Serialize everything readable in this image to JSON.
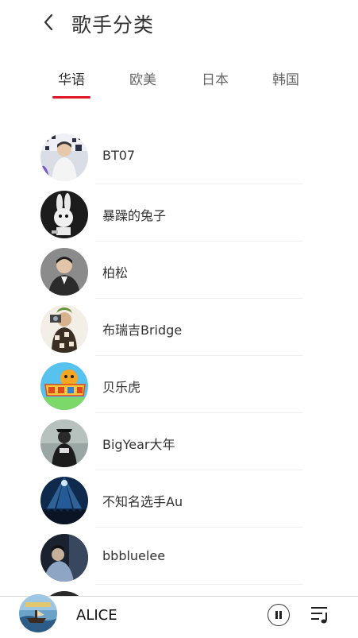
{
  "header": {
    "title": "歌手分类",
    "back_icon": "chevron-left-icon"
  },
  "tabs": [
    {
      "label": "华语",
      "active": true
    },
    {
      "label": "欧美",
      "active": false
    },
    {
      "label": "日本",
      "active": false
    },
    {
      "label": "韩国",
      "active": false
    }
  ],
  "colors": {
    "accent": "#e0132d"
  },
  "artists": [
    {
      "name": "BT07"
    },
    {
      "name": "暴躁的兔子"
    },
    {
      "name": "柏松"
    },
    {
      "name": "布瑞吉Bridge"
    },
    {
      "name": "贝乐虎"
    },
    {
      "name": "BigYear大年"
    },
    {
      "name": "不知名选手Au"
    },
    {
      "name": "bbbluelee"
    }
  ],
  "player": {
    "song_title": "ALICE",
    "play_state_icon": "pause-icon",
    "playlist_icon": "playlist-icon"
  }
}
